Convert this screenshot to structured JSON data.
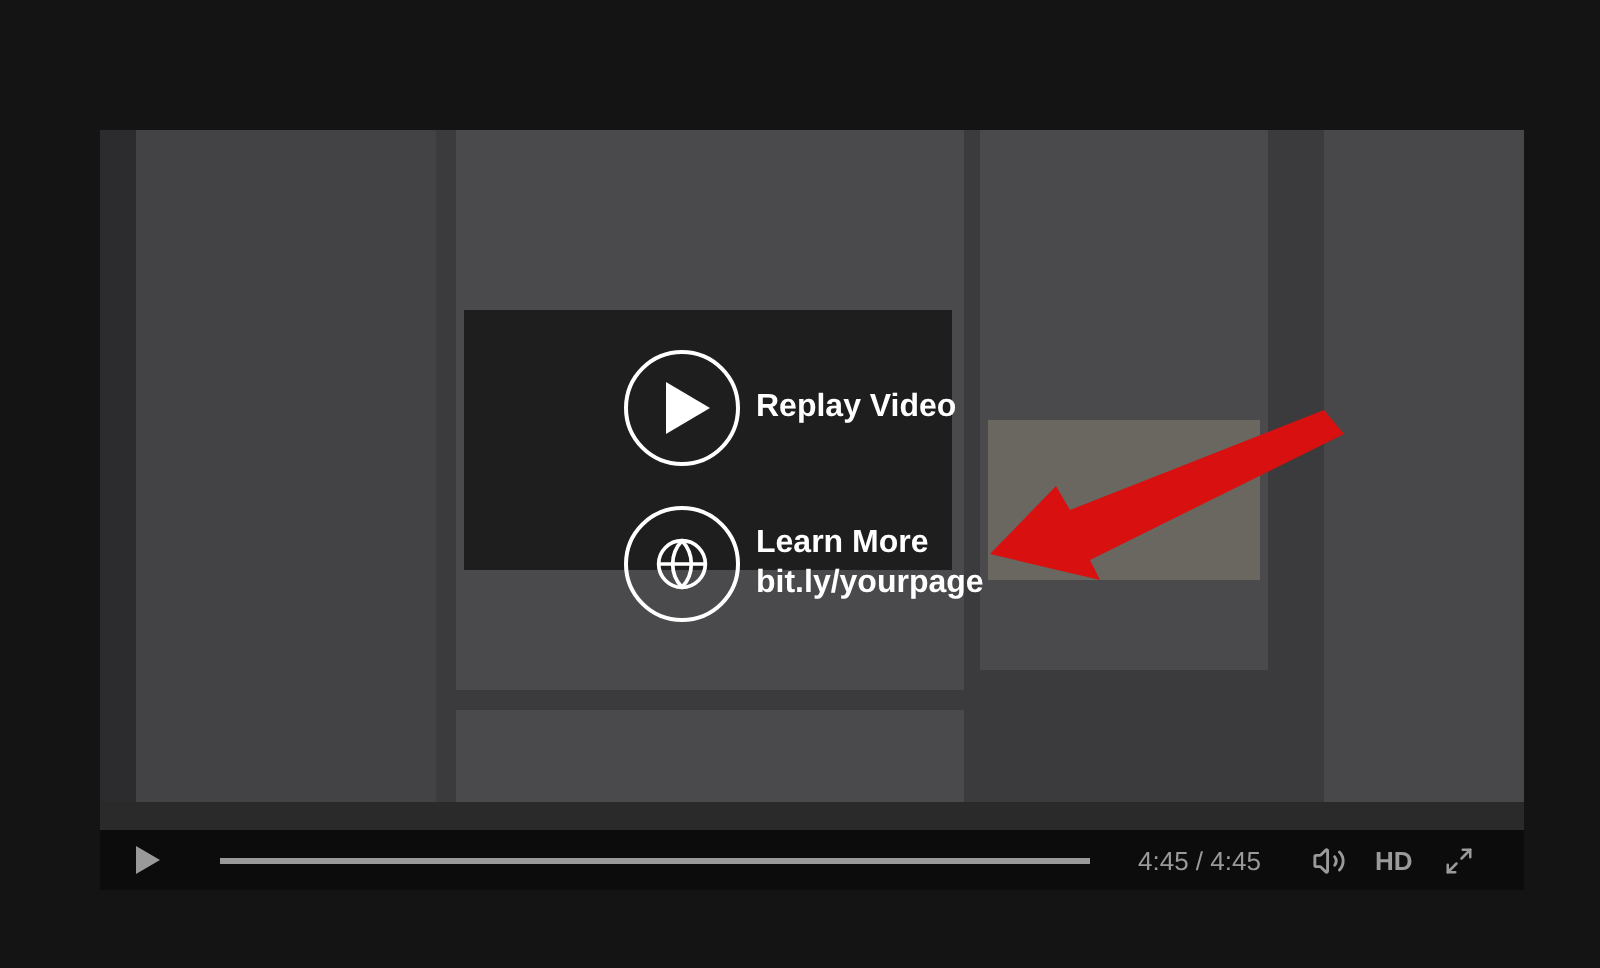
{
  "overlay": {
    "replay": {
      "label": "Replay Video"
    },
    "learn_more": {
      "label": "Learn More",
      "url": "bit.ly/yourpage"
    }
  },
  "controls": {
    "playing": false,
    "progress": {
      "level": 1
    },
    "time": "4:45 / 4:45",
    "quality": "HD"
  }
}
